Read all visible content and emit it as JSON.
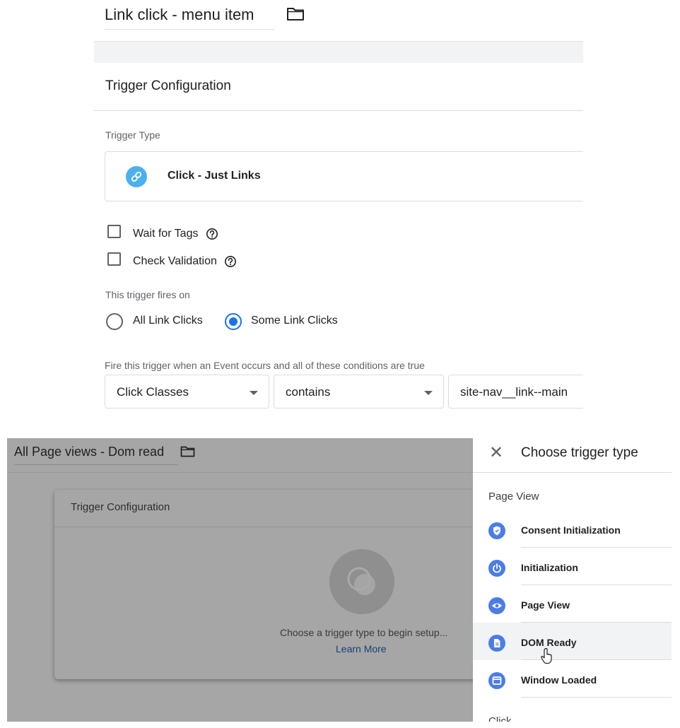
{
  "top_panel": {
    "trigger_name": "Link click - menu item",
    "section_title": "Trigger Configuration",
    "trigger_type_label": "Trigger Type",
    "trigger_type_value": "Click - Just Links",
    "options": [
      {
        "label": "Wait for Tags",
        "checked": false
      },
      {
        "label": "Check Validation",
        "checked": false
      }
    ],
    "fires_on_label": "This trigger fires on",
    "fires_on": [
      {
        "label": "All Link Clicks",
        "selected": false
      },
      {
        "label": "Some Link Clicks",
        "selected": true
      }
    ],
    "condition_label": "Fire this trigger when an Event occurs and all of these conditions are true",
    "condition": {
      "variable": "Click Classes",
      "operator": "contains",
      "value": "site-nav__link--main"
    }
  },
  "bottom_panel": {
    "trigger_name": "All Page views - Dom read",
    "section_title": "Trigger Configuration",
    "empty_hint": "Choose a trigger type to begin setup...",
    "learn_more": "Learn More",
    "drawer": {
      "title": "Choose trigger type",
      "section": "Page View",
      "items": [
        {
          "label": "Consent Initialization",
          "icon": "shield-icon"
        },
        {
          "label": "Initialization",
          "icon": "power-icon"
        },
        {
          "label": "Page View",
          "icon": "eye-icon"
        },
        {
          "label": "DOM Ready",
          "icon": "document-icon",
          "hovered": true
        },
        {
          "label": "Window Loaded",
          "icon": "window-icon"
        }
      ],
      "next_section_partial": "Click"
    }
  },
  "colors": {
    "accent": "#1a73e8",
    "link_icon": "#4ab0f0",
    "trigger_icon": "#4b7de6",
    "overlay": "#a6a6a6"
  }
}
